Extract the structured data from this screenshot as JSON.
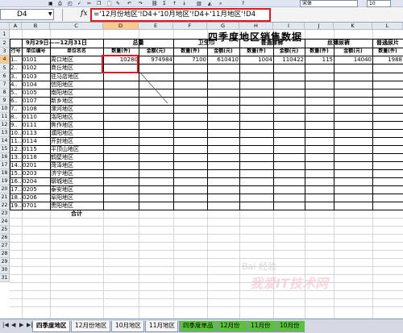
{
  "toolbar": {
    "font": "宋体",
    "size": "10"
  },
  "formula_bar": {
    "name_box": "D4",
    "formula": "='12月份地区'!D4+'10月地区'!D4+'11月地区'!D4"
  },
  "columns": [
    "A",
    "B",
    "C",
    "D",
    "E",
    "F",
    "G",
    "H",
    "I",
    "J",
    "K",
    "L"
  ],
  "rows": [
    "1",
    "2",
    "3",
    "4",
    "5",
    "6",
    "7",
    "8",
    "9",
    "10",
    "11",
    "12",
    "13",
    "14",
    "15",
    "16",
    "17",
    "18",
    "19",
    "20",
    "21",
    "22",
    "23",
    "24",
    "25",
    "26",
    "27",
    "28",
    "29",
    "30",
    "31"
  ],
  "sheet": {
    "title": "四季度地区销售数据",
    "date_range": "9月29日——12月31日",
    "header_groups": [
      "总量",
      "卫生巾",
      "普通尿裤",
      "丝薄尿裤",
      "普通尿片"
    ],
    "header_row": [
      "行号",
      "单位编号",
      "单位名名",
      "数量(件)",
      "金额(元)",
      "数量(件)",
      "金额(元)",
      "数量(件)",
      "金额(元)",
      "数量(件)",
      "金额(元)",
      "数量(件)"
    ],
    "data_rows": [
      {
        "row_no": "1..",
        "code": "0101",
        "name": "周口地区",
        "v1": "10280",
        "v2": "974984",
        "v3": "7100",
        "v4": "610410",
        "v5": "1004",
        "v6": "110422",
        "v7": "115",
        "v8": "14040",
        "v9": "1988"
      },
      {
        "row_no": "2..",
        "code": "0102",
        "name": "商丘地区"
      },
      {
        "row_no": "3..",
        "code": "0103",
        "name": "驻马店地区"
      },
      {
        "row_no": "4..",
        "code": "0104",
        "name": "信阳地区"
      },
      {
        "row_no": "5..",
        "code": "0105",
        "name": "南阳地区"
      },
      {
        "row_no": "6..",
        "code": "0107",
        "name": "新乡地区"
      },
      {
        "row_no": "7..",
        "code": "0108",
        "name": "漯河地区"
      },
      {
        "row_no": "8..",
        "code": "0110",
        "name": "洛阳地区"
      },
      {
        "row_no": "9..",
        "code": "0111",
        "name": "焦作地区"
      },
      {
        "row_no": "10..",
        "code": "0113",
        "name": "濮阳地区"
      },
      {
        "row_no": "11..",
        "code": "0114",
        "name": "开封地区"
      },
      {
        "row_no": "12..",
        "code": "0115",
        "name": "平顶山地区"
      },
      {
        "row_no": "13..",
        "code": "0118",
        "name": "鹤壁地区"
      },
      {
        "row_no": "14..",
        "code": "0201",
        "name": "菏泽地区"
      },
      {
        "row_no": "15..",
        "code": "0203",
        "name": "济宁地区"
      },
      {
        "row_no": "16..",
        "code": "0204",
        "name": "聊城地区"
      },
      {
        "row_no": "17..",
        "code": "0205",
        "name": "泰安地区"
      },
      {
        "row_no": "18..",
        "code": "0206",
        "name": "阜阳地区"
      },
      {
        "row_no": "19..",
        "code": "0701",
        "name": "贵阳地区"
      }
    ],
    "total_label": "合计"
  },
  "tabs": [
    "四季度地区",
    "12月份地区",
    "10月地区",
    "11月地区",
    "四季度单品",
    "12月份",
    "11月份",
    "10月份"
  ],
  "watermark": {
    "text": "我爱IT技术网",
    "sub": "Bai 经验"
  }
}
